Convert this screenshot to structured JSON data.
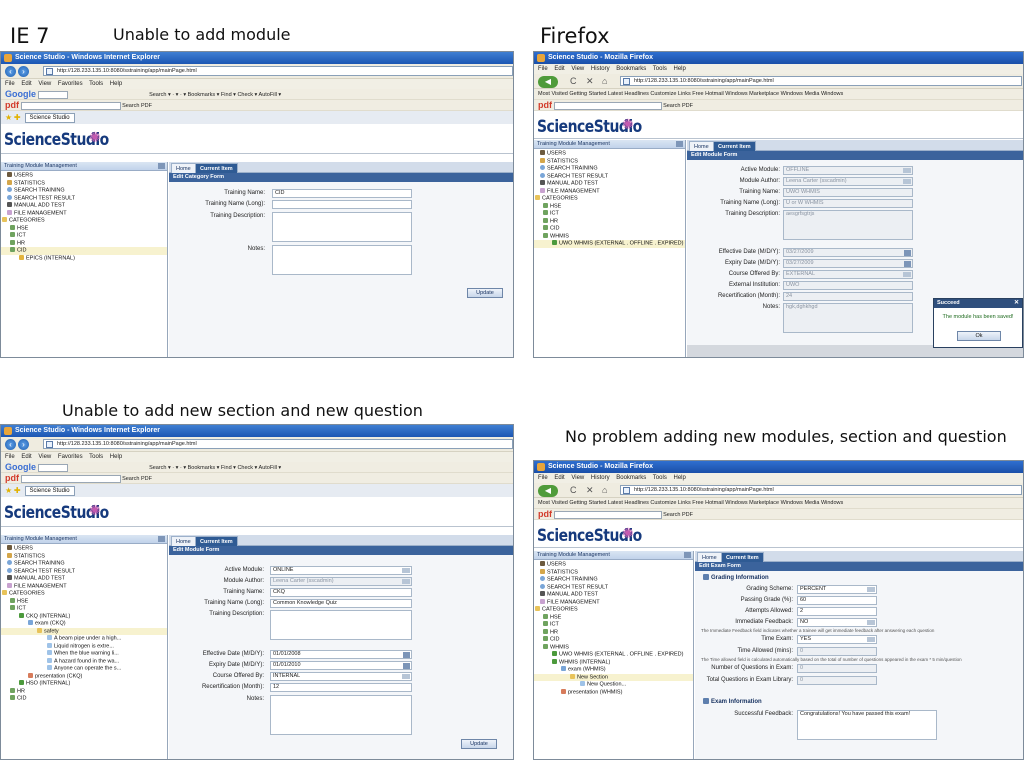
{
  "headings": {
    "ie7": "IE 7",
    "ie7_issue1": "Unable to add module",
    "firefox": "Firefox",
    "ie7_issue2": "Unable to add new section and new question",
    "firefox_ok": "No problem adding new modules, section and question"
  },
  "browser": {
    "ie_title": "Science Studio - Windows Internet Explorer",
    "ff_title": "Science Studio - Mozilla Firefox",
    "url": "http://128.233.135.10:8080/sstraining/app/mainPage.html",
    "ie_menu": "File Edit View Favorites Tools Help",
    "ff_menu": "File Edit View History Bookmarks Tools Help",
    "ie_toolbar": "Search ▾ · ▾ · ▾ Bookmarks ▾ Find ▾ Check ▾ AutoFill ▾",
    "ie_pdf_toolbar": "Search  PDF",
    "ie_tab": "Science Studio",
    "ff_bookmarks": "Most Visited   Getting Started   Latest Headlines   Customize Links   Free Hotmail   Windows Marketplace   Windows Media   Windows",
    "ff_search": "Search   PDF",
    "google_label": "Google",
    "pdf_label": "pdf"
  },
  "app": {
    "brand": "ScienceStudio",
    "left_title": "Training Module Management",
    "tab_home": "Home",
    "tab_current": "Current Item",
    "update": "Update"
  },
  "panel1": {
    "form_title": "Edit Category Form",
    "tree": [
      "USERS",
      "STATISTICS",
      "SEARCH TRAINING",
      "SEARCH TEST RESULT",
      "MANUAL ADD TEST",
      "FILE MANAGEMENT",
      "CATEGORIES",
      "HSE",
      "ICT",
      "HR",
      "CID",
      "EPICS (INTERNAL)"
    ],
    "labels": {
      "name": "Training Name:",
      "long": "Training Name (Long):",
      "desc": "Training Description:",
      "notes": "Notes:"
    },
    "values": {
      "name": "CID"
    }
  },
  "panel2": {
    "form_title": "Edit Module Form",
    "tree": [
      "USERS",
      "STATISTICS",
      "SEARCH TRAINING",
      "SEARCH TEST RESULT",
      "MANUAL ADD TEST",
      "FILE MANAGEMENT",
      "CATEGORIES",
      "HSE",
      "ICT",
      "HR",
      "CID",
      "WHMIS",
      "UWO WHMIS (EXTERNAL . OFFLINE . EXPIRED)"
    ],
    "labels": {
      "active": "Active Module:",
      "author": "Module Author:",
      "name": "Training Name:",
      "long": "Training Name (Long):",
      "desc": "Training Description:",
      "eff": "Effective Date (M/D/Y):",
      "exp": "Expiry Date (M/D/Y):",
      "course": "Course Offered By:",
      "inst": "External Institution:",
      "recert": "Recertification (Month):",
      "notes": "Notes:"
    },
    "values": {
      "active": "OFFLINE",
      "author": "Leena Carter (sscadmin)",
      "name": "UWO WHMIS",
      "long": "U or W WHMIS",
      "desc": "aesgrfsgtrjs",
      "eff": "03/27/2009",
      "exp": "03/27/2009",
      "course": "EXTERNAL",
      "inst": "UWO",
      "recert": "24",
      "notes": "hgk,dghkhgd"
    },
    "toast_title": "Succeed",
    "toast_message": "The module has been saved!",
    "toast_ok": "Ok"
  },
  "panel3": {
    "form_title": "Edit Module Form",
    "tree": [
      "USERS",
      "STATISTICS",
      "SEARCH TRAINING",
      "SEARCH TEST RESULT",
      "MANUAL ADD TEST",
      "FILE MANAGEMENT",
      "CATEGORIES",
      "HSE",
      "ICT",
      "CKQ (INTERNAL)",
      "exam (CKQ)",
      "safety",
      "A beam pipe under a high...",
      "Liquid nitrogen is extre...",
      "When the blue warning li...",
      "A hazard found in the wa...",
      "Anyone can operate the s...",
      "presentation (CKQ)",
      "HSO (INTERNAL)",
      "HR",
      "CID"
    ],
    "labels": {
      "active": "Active Module:",
      "author": "Module Author:",
      "name": "Training Name:",
      "long": "Training Name (Long):",
      "desc": "Training Description:",
      "eff": "Effective Date (M/D/Y):",
      "exp": "Expiry Date (M/D/Y):",
      "course": "Course Offered By:",
      "recert": "Recertification (Month):",
      "notes": "Notes:"
    },
    "values": {
      "active": "ONLINE",
      "author": "Leena Carter (sscadmin)",
      "name": "CKQ",
      "long": "Common Knowledge Quiz",
      "eff": "01/01/2008",
      "exp": "01/01/2010",
      "course": "INTERNAL",
      "recert": "12"
    }
  },
  "panel4": {
    "form_title": "Edit Exam Form",
    "tree": [
      "USERS",
      "STATISTICS",
      "SEARCH TRAINING",
      "SEARCH TEST RESULT",
      "MANUAL ADD TEST",
      "FILE MANAGEMENT",
      "CATEGORIES",
      "HSE",
      "ICT",
      "HR",
      "CID",
      "WHMIS",
      "UWO WHMIS (EXTERNAL . OFFLINE . EXPIRED)",
      "WHMIS (INTERNAL)",
      "exam (WHMIS)",
      "New Section",
      "New Question...",
      "presentation (WHMIS)"
    ],
    "grading_title": "Grading Information",
    "exam_title": "Exam Information",
    "labels": {
      "scheme": "Grading Scheme:",
      "pass": "Passing Grade (%):",
      "attempts": "Attempts Allowed:",
      "immediate": "Immediate Feedback:",
      "timed": "Time Exam:",
      "allowed": "Time Allowed (mins):",
      "numq": "Number of Questions in Exam:",
      "total": "Total Questions in Exam Library:",
      "success": "Successful Feedback:"
    },
    "values": {
      "scheme": "PERCENT",
      "pass": "60",
      "attempts": "2",
      "immediate": "NO",
      "timed": "YES",
      "allowed": "0",
      "numq": "0",
      "total": "0",
      "success": "Congratulations! You have passed this exam!"
    },
    "note1": "The Immediate Feedback field indicates whether a trainee will get immediate feedback after answering each question",
    "note2": "The Time allowed field is calculated automatically based on the total of number of questions appeared in the exam * 5 min/question"
  }
}
